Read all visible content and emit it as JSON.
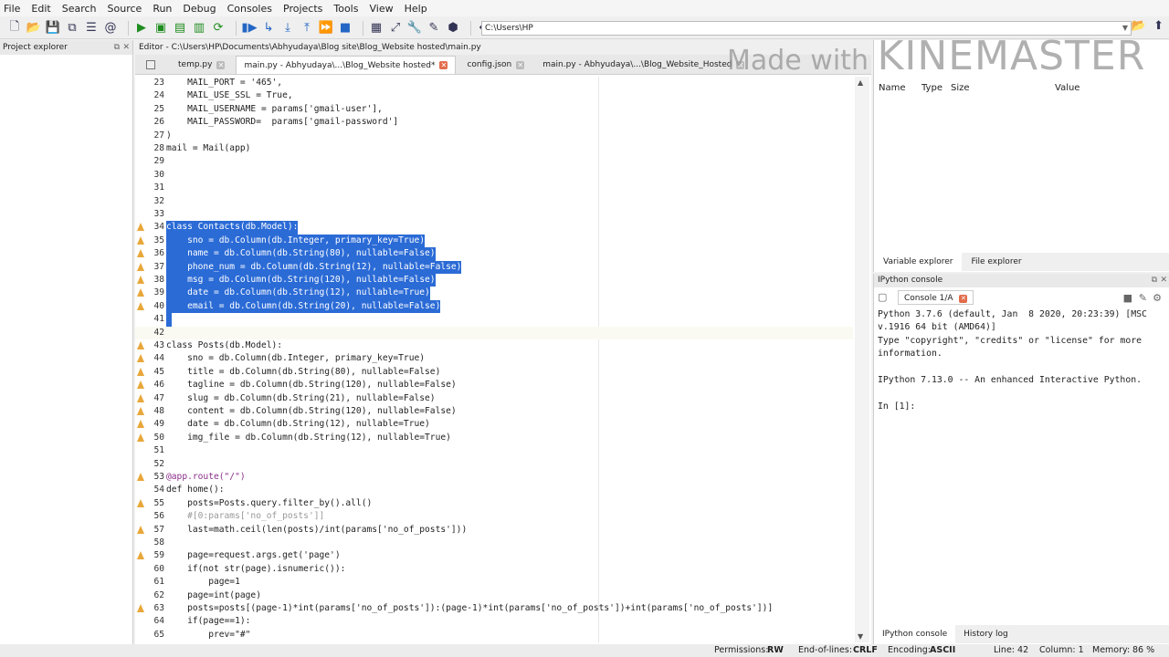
{
  "menu": [
    "File",
    "Edit",
    "Search",
    "Source",
    "Run",
    "Debug",
    "Consoles",
    "Projects",
    "Tools",
    "View",
    "Help"
  ],
  "toolbar": {
    "path": "C:\\Users\\HP"
  },
  "panels": {
    "project_explorer": "Project explorer",
    "editor_title": "Editor - C:\\Users\\HP\\Documents\\Abhyudaya\\Blog site\\Blog_Website hosted\\main.py",
    "variable_explorer_title": "Variable explorer",
    "ipython_title": "IPython console"
  },
  "tabs": [
    {
      "label": "temp.py"
    },
    {
      "label": "main.py - Abhyudaya\\...\\Blog_Website hosted*"
    },
    {
      "label": "config.json"
    },
    {
      "label": "main.py - Abhyudaya\\...\\Blog_Website_Hosted"
    }
  ],
  "code_lines": [
    {
      "n": "23",
      "t": "    MAIL_PORT = '465',"
    },
    {
      "n": "24",
      "t": "    MAIL_USE_SSL = True,"
    },
    {
      "n": "25",
      "t": "    MAIL_USERNAME = params['gmail-user'],"
    },
    {
      "n": "26",
      "t": "    MAIL_PASSWORD=  params['gmail-password']"
    },
    {
      "n": "27",
      "t": ")"
    },
    {
      "n": "28",
      "t": "mail = Mail(app)"
    },
    {
      "n": "29",
      "t": ""
    },
    {
      "n": "30",
      "t": ""
    },
    {
      "n": "31",
      "t": ""
    },
    {
      "n": "32",
      "t": ""
    },
    {
      "n": "33",
      "t": ""
    },
    {
      "n": "34",
      "t": "class Contacts(db.Model):"
    },
    {
      "n": "35",
      "t": "    sno = db.Column(db.Integer, primary_key=True)"
    },
    {
      "n": "36",
      "t": "    name = db.Column(db.String(80), nullable=False)"
    },
    {
      "n": "37",
      "t": "    phone_num = db.Column(db.String(12), nullable=False)"
    },
    {
      "n": "38",
      "t": "    msg = db.Column(db.String(120), nullable=False)"
    },
    {
      "n": "39",
      "t": "    date = db.Column(db.String(12), nullable=True)"
    },
    {
      "n": "40",
      "t": "    email = db.Column(db.String(20), nullable=False)"
    },
    {
      "n": "41",
      "t": ""
    },
    {
      "n": "42",
      "t": ""
    },
    {
      "n": "43",
      "t": "class Posts(db.Model):"
    },
    {
      "n": "44",
      "t": "    sno = db.Column(db.Integer, primary_key=True)"
    },
    {
      "n": "45",
      "t": "    title = db.Column(db.String(80), nullable=False)"
    },
    {
      "n": "46",
      "t": "    tagline = db.Column(db.String(120), nullable=False)"
    },
    {
      "n": "47",
      "t": "    slug = db.Column(db.String(21), nullable=False)"
    },
    {
      "n": "48",
      "t": "    content = db.Column(db.String(120), nullable=False)"
    },
    {
      "n": "49",
      "t": "    date = db.Column(db.String(12), nullable=True)"
    },
    {
      "n": "50",
      "t": "    img_file = db.Column(db.String(12), nullable=True)"
    },
    {
      "n": "51",
      "t": ""
    },
    {
      "n": "52",
      "t": ""
    },
    {
      "n": "53",
      "t": "@app.route(\"/\")"
    },
    {
      "n": "54",
      "t": "def home():"
    },
    {
      "n": "55",
      "t": "    posts=Posts.query.filter_by().all()"
    },
    {
      "n": "56",
      "t": "    #[0:params['no_of_posts']]"
    },
    {
      "n": "57",
      "t": "    last=math.ceil(len(posts)/int(params['no_of_posts']))"
    },
    {
      "n": "58",
      "t": ""
    },
    {
      "n": "59",
      "t": "    page=request.args.get('page')"
    },
    {
      "n": "60",
      "t": "    if(not str(page).isnumeric()):"
    },
    {
      "n": "61",
      "t": "        page=1"
    },
    {
      "n": "62",
      "t": "    page=int(page)"
    },
    {
      "n": "63",
      "t": "    posts=posts[(page-1)*int(params['no_of_posts']):(page-1)*int(params['no_of_posts'])+int(params['no_of_posts'])]"
    },
    {
      "n": "64",
      "t": "    if(page==1):"
    },
    {
      "n": "65",
      "t": "        prev=\"#\""
    }
  ],
  "variable_explorer": {
    "columns": [
      "Name",
      "Type",
      "Size",
      "Value"
    ],
    "tabs": [
      "Variable explorer",
      "File explorer"
    ]
  },
  "console": {
    "tab": "Console 1/A",
    "lines": [
      "Python 3.7.6 (default, Jan  8 2020, 20:23:39) [MSC",
      "v.1916 64 bit (AMD64)]",
      "Type \"copyright\", \"credits\" or \"license\" for more",
      "information.",
      "",
      "IPython 7.13.0 -- An enhanced Interactive Python.",
      "",
      "In [1]:"
    ],
    "bottom_tabs": [
      "IPython console",
      "History log"
    ]
  },
  "status": {
    "permissions_label": "Permissions:",
    "permissions": "RW",
    "eol_label": "End-of-lines:",
    "eol": "CRLF",
    "encoding_label": "Encoding:",
    "encoding": "ASCII",
    "line_label": "Line: 42",
    "column_label": "Column: 1",
    "memory_label": "Memory:",
    "memory": "86 %"
  },
  "watermark": {
    "prefix": "Made with",
    "brand": "KINEMASTER"
  }
}
